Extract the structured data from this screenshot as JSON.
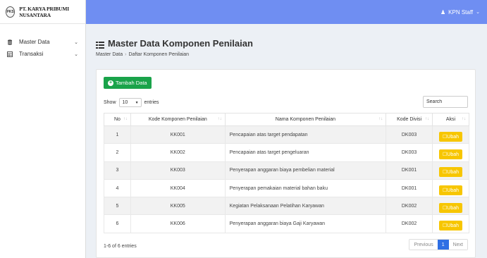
{
  "brand": {
    "logo_text": "PKS",
    "name": "PT. KARYA PRIBUMI NUSANTARA"
  },
  "sidebar": {
    "items": [
      {
        "label": "Master Data"
      },
      {
        "label": "Transaksi"
      }
    ]
  },
  "topbar": {
    "user": "KPN Staff"
  },
  "page": {
    "title": "Master Data Komponen Penilaian",
    "breadcrumb": [
      "Master Data",
      "Daftar Komponen Penilaian"
    ]
  },
  "toolbar": {
    "add_label": "Tambah Data"
  },
  "length": {
    "show_label": "Show",
    "value": "10",
    "entries_label": "entries"
  },
  "search": {
    "label": "Search",
    "placeholder": ""
  },
  "table": {
    "headers": [
      "No",
      "Kode Komponen Penilaian",
      "Nama Komponen Penilaian",
      "Kode Divisi",
      "Aksi"
    ],
    "rows": [
      {
        "no": "1",
        "kode": "KK001",
        "nama": "Pencapaian atas target pendapatan",
        "divisi": "DK003",
        "aksi": "Ubah"
      },
      {
        "no": "2",
        "kode": "KK002",
        "nama": "Pencapaian atas target pengeluaran",
        "divisi": "DK003",
        "aksi": "Ubah"
      },
      {
        "no": "3",
        "kode": "KK003",
        "nama": "Penyerapan anggaran biaya pembelian material",
        "divisi": "DK001",
        "aksi": "Ubah"
      },
      {
        "no": "4",
        "kode": "KK004",
        "nama": "Penyerapan pemakaian material bahan baku",
        "divisi": "DK001",
        "aksi": "Ubah"
      },
      {
        "no": "5",
        "kode": "KK005",
        "nama": "Kegiatan Pelaksanaan Pelatihan Karyawan",
        "divisi": "DK002",
        "aksi": "Ubah"
      },
      {
        "no": "6",
        "kode": "KK006",
        "nama": "Penyerapan anggaran biaya Gaji Karyawan",
        "divisi": "DK002",
        "aksi": "Ubah"
      }
    ]
  },
  "footer": {
    "info": "1-6 of 6 entries",
    "prev": "Previous",
    "page": "1",
    "next": "Next"
  },
  "colors": {
    "topbar": "#6f8ef2",
    "add_button": "#1aa34a",
    "edit_button": "#f7c600",
    "active_page": "#2f6fe4"
  }
}
